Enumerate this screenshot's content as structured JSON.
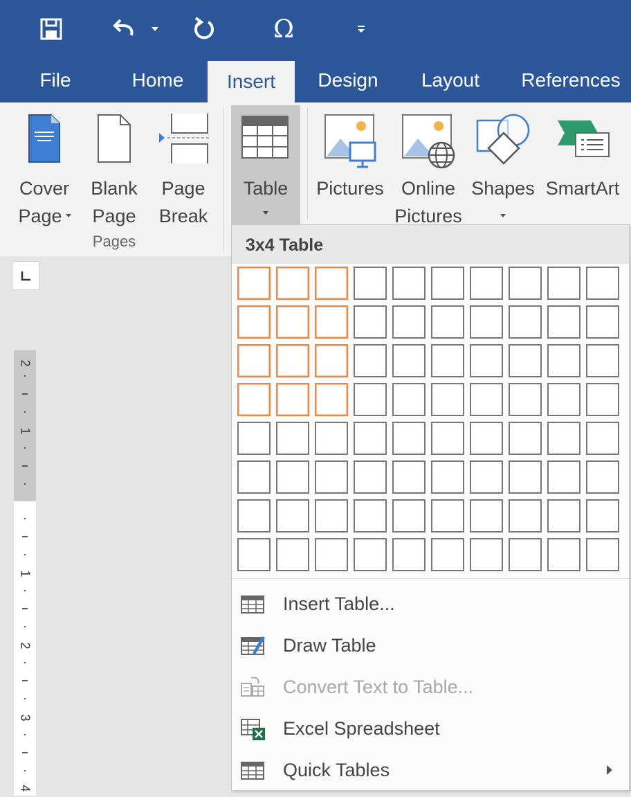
{
  "tabs": [
    {
      "label": "File"
    },
    {
      "label": "Home"
    },
    {
      "label": "Insert"
    },
    {
      "label": "Design"
    },
    {
      "label": "Layout"
    },
    {
      "label": "References"
    }
  ],
  "active_tab": "Insert",
  "ribbon": {
    "cover_page": {
      "line1": "Cover",
      "line2": "Page"
    },
    "blank_page": {
      "line1": "Blank",
      "line2": "Page"
    },
    "page_break": {
      "line1": "Page",
      "line2": "Break"
    },
    "pages_group_label": "Pages",
    "table": {
      "label": "Table"
    },
    "pictures": {
      "label": "Pictures"
    },
    "online_pictures": {
      "line1": "Online",
      "line2": "Pictures"
    },
    "shapes": {
      "label": "Shapes"
    },
    "smartart": {
      "label": "SmartArt"
    }
  },
  "table_menu": {
    "header": "3x4 Table",
    "grid": {
      "columns": 10,
      "rows": 8,
      "selected_columns": 3,
      "selected_rows": 4
    },
    "items": [
      {
        "label": "Insert Table...",
        "enabled": true
      },
      {
        "label": "Draw Table",
        "enabled": true
      },
      {
        "label": "Convert Text to Table...",
        "enabled": false
      },
      {
        "label": "Excel Spreadsheet",
        "enabled": true
      },
      {
        "label": "Quick Tables",
        "enabled": true,
        "submenu": true
      }
    ]
  },
  "ruler": {
    "numbers": [
      "2",
      "1",
      "1",
      "2",
      "3",
      "4"
    ]
  },
  "colors": {
    "title_bar": "#2b579a",
    "selection_border": "#ee8644",
    "ribbon_bg": "#f3f3f3",
    "document_bg": "#e6e6e6"
  },
  "icons": {
    "qat": [
      "save-icon",
      "undo-icon",
      "undo-dropdown-icon",
      "redo-icon",
      "symbol-omega-icon",
      "customize-qat-icon"
    ]
  }
}
